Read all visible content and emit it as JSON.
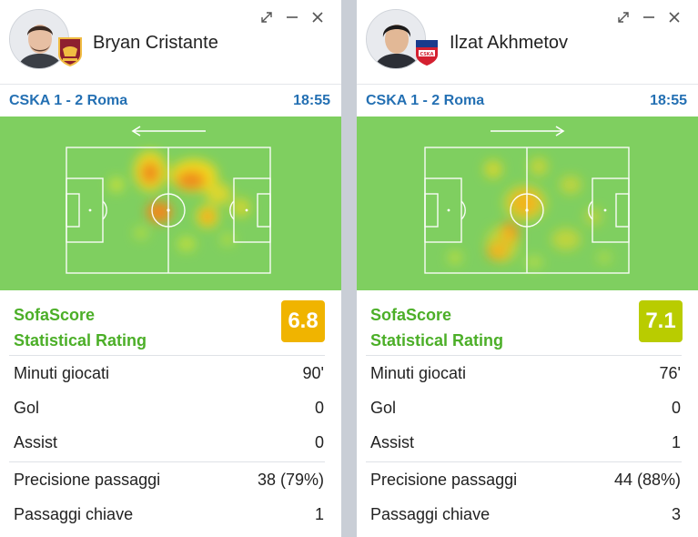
{
  "cards": [
    {
      "player_name": "Bryan Cristante",
      "team_logo": "roma-crest-icon",
      "match": {
        "title": "CSKA 1 - 2 Roma",
        "time": "18:55"
      },
      "heatmap_direction": "left",
      "rating": {
        "label_line1": "SofaScore",
        "label_line2": "Statistical Rating",
        "value": "6.8",
        "color": "#f0b400"
      },
      "stats": [
        {
          "label": "Minuti giocati",
          "value": "90'"
        },
        {
          "label": "Gol",
          "value": "0"
        },
        {
          "label": "Assist",
          "value": "0"
        },
        {
          "label": "Precisione passaggi",
          "value": "38 (79%)"
        },
        {
          "label": "Passaggi chiave",
          "value": "1"
        }
      ]
    },
    {
      "player_name": "Ilzat Akhmetov",
      "team_logo": "cska-crest-icon",
      "match": {
        "title": "CSKA 1 - 2 Roma",
        "time": "18:55"
      },
      "heatmap_direction": "right",
      "rating": {
        "label_line1": "SofaScore",
        "label_line2": "Statistical Rating",
        "value": "7.1",
        "color": "#b9cc00"
      },
      "stats": [
        {
          "label": "Minuti giocati",
          "value": "76'"
        },
        {
          "label": "Gol",
          "value": "0"
        },
        {
          "label": "Assist",
          "value": "1"
        },
        {
          "label": "Precisione passaggi",
          "value": "44 (88%)"
        },
        {
          "label": "Passaggi chiave",
          "value": "3"
        }
      ]
    }
  ],
  "colors": {
    "pitch": "#7fcf60",
    "accent_blue": "#2470b3",
    "rating_green": "#4caf28"
  }
}
